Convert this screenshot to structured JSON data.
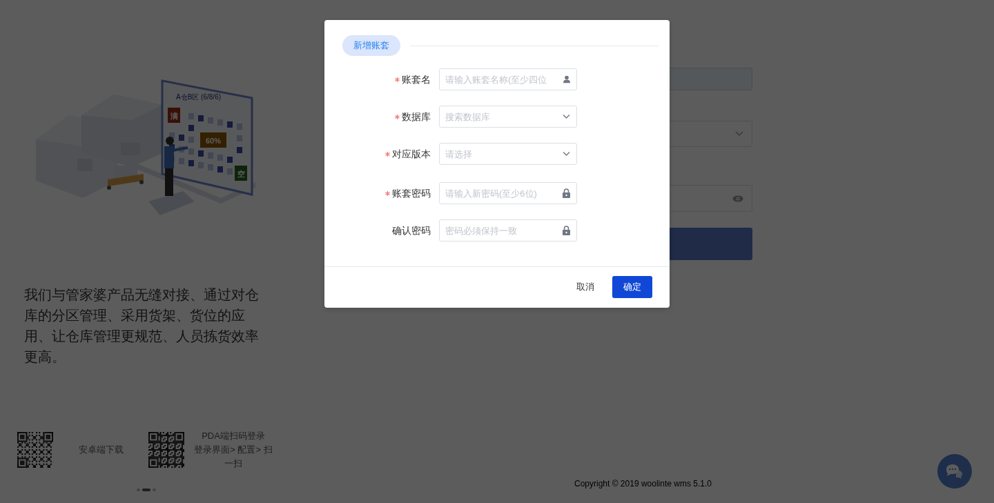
{
  "background": {
    "illustration_labels": [
      "A仓B区 (6/8/6)",
      "满",
      "60%",
      "空"
    ],
    "description": "我们与管家婆产品无缝对接、通过对仓库的分区管理、采用货架、货位的应用、让仓库管理更规范、人员拣货效率更高。",
    "downloads": [
      {
        "title": "安卓端下载"
      },
      {
        "title": "PDA端扫码登录",
        "hint": "登录界面> 配置> 扫一扫"
      }
    ],
    "carousel_dots": [
      {
        "selected": false
      },
      {
        "selected": true
      },
      {
        "selected": false
      }
    ],
    "login_form": {
      "fields": [
        {
          "kind": "text"
        },
        {
          "kind": "select"
        },
        {
          "kind": "password"
        }
      ]
    },
    "copyright": "Copyright © 2019 woolinte wms 5.1.0"
  },
  "modal": {
    "tag": "新增账套",
    "fields": [
      {
        "label": "账套名",
        "required": true,
        "placeholder": "请输入账套名称(至少四位",
        "kind": "text"
      },
      {
        "label": "数据库",
        "required": true,
        "placeholder": "搜索数据库",
        "kind": "select"
      },
      {
        "label": "对应版本",
        "required": true,
        "placeholder": "请选择",
        "kind": "select"
      },
      {
        "label": "账套密码",
        "required": true,
        "placeholder": "请输入新密码(至少6位)",
        "kind": "password"
      },
      {
        "label": "确认密码",
        "required": false,
        "placeholder": "密码必须保持一致",
        "kind": "password"
      }
    ],
    "buttons": [
      {
        "label": "取消",
        "kind": "text"
      },
      {
        "label": "确定",
        "kind": "primary"
      }
    ]
  }
}
